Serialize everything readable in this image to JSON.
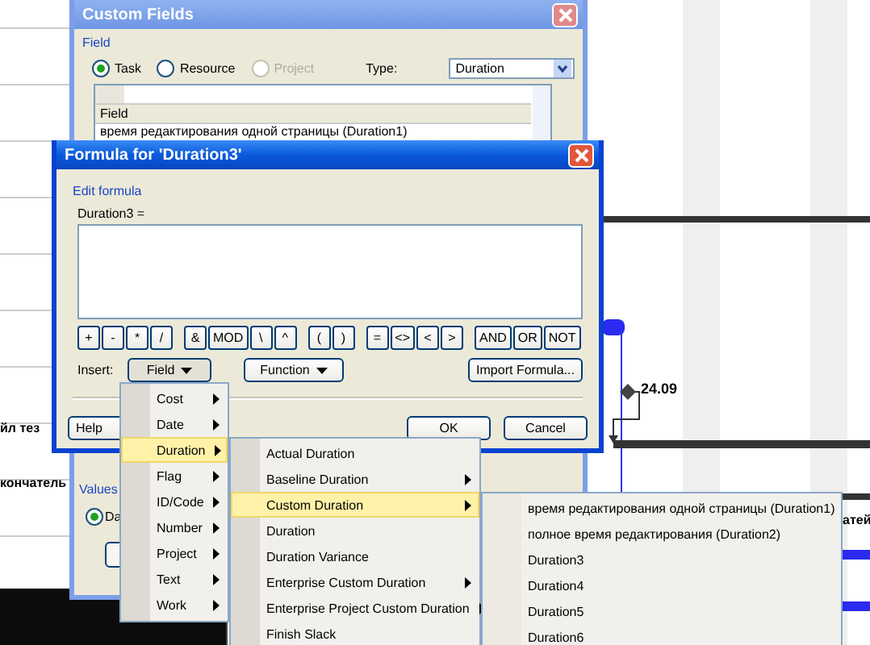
{
  "background_table": {
    "rows": [
      {
        "text": "йл тез"
      },
      {
        "text": "кончатель"
      }
    ]
  },
  "gantt": {
    "milestone_label": "24.09",
    "row_label": "атей"
  },
  "custom_fields": {
    "title": "Custom Fields",
    "group_label": "Field",
    "entity_options": [
      {
        "label": "Task",
        "selected": true,
        "disabled": false
      },
      {
        "label": "Resource",
        "selected": false,
        "disabled": false
      },
      {
        "label": "Project",
        "selected": false,
        "disabled": true
      }
    ],
    "type_label": "Type:",
    "type_value": "Duration",
    "list_header": "Field",
    "list_rows": [
      "время редактирования одной страницы (Duration1)"
    ],
    "values_label": "Values",
    "values_option": {
      "label": "Da",
      "selected": true
    }
  },
  "formula": {
    "title": "Formula for 'Duration3'",
    "group_label": "Edit formula",
    "expression_label": "Duration3 =",
    "operator_groups": [
      [
        "+",
        "-",
        "*",
        "/"
      ],
      [
        "&",
        "MOD",
        "\\",
        "^"
      ],
      [
        "(",
        ")"
      ],
      [
        "=",
        "<>",
        "<",
        ">"
      ],
      [
        "AND",
        "OR",
        "NOT"
      ]
    ],
    "insert_label": "Insert:",
    "insert_buttons": [
      "Field",
      "Function"
    ],
    "import_button": "Import Formula...",
    "help_button": "Help",
    "ok_button": "OK",
    "cancel_button": "Cancel"
  },
  "menus": [
    {
      "items": [
        {
          "label": "Cost",
          "submenu": true,
          "selected": false
        },
        {
          "label": "Date",
          "submenu": true,
          "selected": false
        },
        {
          "label": "Duration",
          "submenu": true,
          "selected": true
        },
        {
          "label": "Flag",
          "submenu": true,
          "selected": false
        },
        {
          "label": "ID/Code",
          "submenu": true,
          "selected": false
        },
        {
          "label": "Number",
          "submenu": true,
          "selected": false
        },
        {
          "label": "Project",
          "submenu": true,
          "selected": false
        },
        {
          "label": "Text",
          "submenu": true,
          "selected": false
        },
        {
          "label": "Work",
          "submenu": true,
          "selected": false
        }
      ]
    },
    {
      "items": [
        {
          "label": "Actual Duration",
          "submenu": false,
          "selected": false
        },
        {
          "label": "Baseline Duration",
          "submenu": true,
          "selected": false
        },
        {
          "label": "Custom Duration",
          "submenu": true,
          "selected": true
        },
        {
          "label": "Duration",
          "submenu": false,
          "selected": false
        },
        {
          "label": "Duration Variance",
          "submenu": false,
          "selected": false
        },
        {
          "label": "Enterprise Custom Duration",
          "submenu": true,
          "selected": false
        },
        {
          "label": "Enterprise Project Custom Duration",
          "submenu": true,
          "selected": false
        },
        {
          "label": "Finish Slack",
          "submenu": false,
          "selected": false
        }
      ]
    },
    {
      "items": [
        {
          "label": "время редактирования одной страницы (Duration1)",
          "submenu": false,
          "selected": false
        },
        {
          "label": "полное время редактирования (Duration2)",
          "submenu": false,
          "selected": false
        },
        {
          "label": "Duration3",
          "submenu": false,
          "selected": false
        },
        {
          "label": "Duration4",
          "submenu": false,
          "selected": false
        },
        {
          "label": "Duration5",
          "submenu": false,
          "selected": false
        },
        {
          "label": "Duration6",
          "submenu": false,
          "selected": false
        }
      ]
    }
  ]
}
